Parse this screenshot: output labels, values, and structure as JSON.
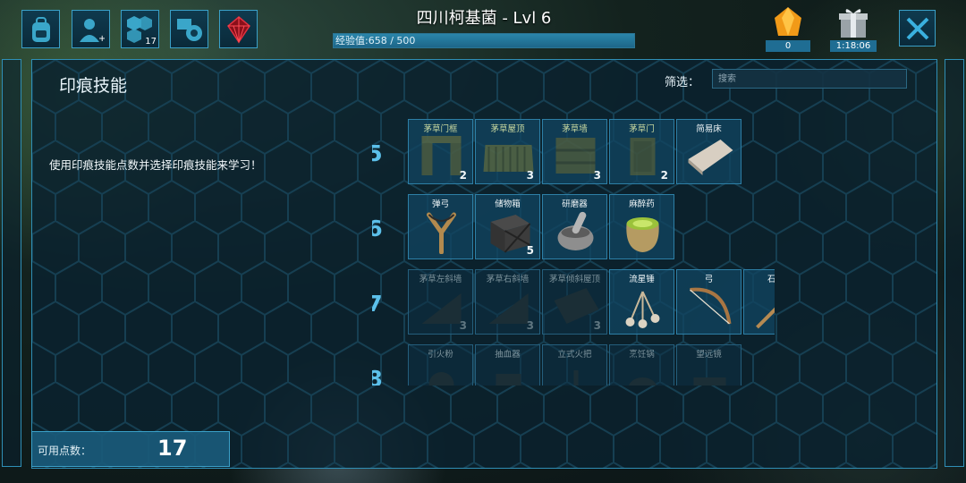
{
  "top_bar": {
    "icons": [
      "backpack-icon",
      "player-add-icon",
      "tribe-icon",
      "engrams-gear-icon",
      "ark-crystal-icon"
    ],
    "tribe_badge": "17",
    "player_title": "四川柯基菌 - Lvl 6",
    "xp_label": "经验值:658 / 500",
    "xp_fraction": 1.0,
    "gems_count": "0",
    "gift_timer": "1:18:06"
  },
  "panel": {
    "title": "印痕技能",
    "filter_label": "筛选：",
    "search_placeholder": "搜索",
    "instructions": "使用印痕技能点数并选择印痕技能来学习！"
  },
  "levels": [
    {
      "level": "5",
      "items": [
        {
          "name": "茅草门框",
          "cost": "2",
          "state": "learned",
          "icon": "thatch-doorframe-icon"
        },
        {
          "name": "茅草屋顶",
          "cost": "3",
          "state": "learned",
          "icon": "thatch-roof-icon"
        },
        {
          "name": "茅草墙",
          "cost": "3",
          "state": "learned",
          "icon": "thatch-wall-icon"
        },
        {
          "name": "茅草门",
          "cost": "2",
          "state": "learned",
          "icon": "thatch-door-icon"
        },
        {
          "name": "简易床",
          "cost": "",
          "state": "available",
          "icon": "simple-bed-icon"
        }
      ]
    },
    {
      "level": "6",
      "items": [
        {
          "name": "弹弓",
          "cost": "",
          "state": "available",
          "icon": "slingshot-icon"
        },
        {
          "name": "储物箱",
          "cost": "5",
          "state": "available",
          "icon": "storage-box-icon"
        },
        {
          "name": "研磨器",
          "cost": "",
          "state": "available",
          "icon": "mortar-pestle-icon"
        },
        {
          "name": "麻醉药",
          "cost": "",
          "state": "available",
          "icon": "narcotic-icon"
        }
      ]
    },
    {
      "level": "7",
      "items": [
        {
          "name": "茅草左斜墙",
          "cost": "3",
          "state": "locked",
          "icon": "thatch-left-sloped-wall-icon"
        },
        {
          "name": "茅草右斜墙",
          "cost": "3",
          "state": "locked",
          "icon": "thatch-right-sloped-wall-icon"
        },
        {
          "name": "茅草倾斜屋顶",
          "cost": "3",
          "state": "locked",
          "icon": "thatch-sloped-roof-icon"
        },
        {
          "name": "流星锤",
          "cost": "",
          "state": "available",
          "icon": "bola-icon"
        },
        {
          "name": "弓",
          "cost": "",
          "state": "available",
          "icon": "bow-icon"
        },
        {
          "name": "石箭",
          "cost": "",
          "state": "available",
          "icon": "stone-arrow-icon"
        }
      ]
    },
    {
      "level": "8",
      "items": [
        {
          "name": "引火粉",
          "cost": "",
          "state": "locked",
          "icon": "sparkpowder-icon"
        },
        {
          "name": "抽血器",
          "cost": "",
          "state": "locked",
          "icon": "blood-extractor-icon"
        },
        {
          "name": "立式火把",
          "cost": "",
          "state": "locked",
          "icon": "standing-torch-icon"
        },
        {
          "name": "烹饪锅",
          "cost": "",
          "state": "locked",
          "icon": "cooking-pot-icon"
        },
        {
          "name": "望远镜",
          "cost": "",
          "state": "locked",
          "icon": "spyglass-icon"
        }
      ]
    }
  ],
  "points": {
    "label": "可用点数：",
    "value": "17"
  },
  "colors": {
    "accent": "#3aa0c8",
    "level_number": "#5cc0ea",
    "slot_bg": "#12465e",
    "panel_bg": "#0a222e"
  }
}
